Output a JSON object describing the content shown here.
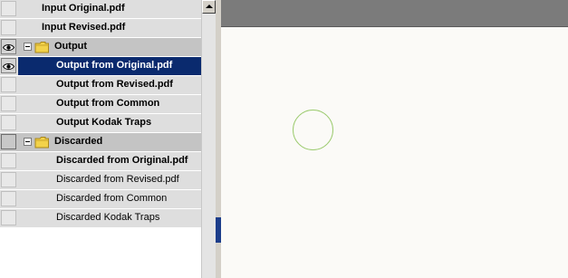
{
  "layers": [
    {
      "label": "Input Original.pdf",
      "type": "item",
      "indent": 0,
      "bold": true,
      "visible": false,
      "selected": false
    },
    {
      "label": "Input Revised.pdf",
      "type": "item",
      "indent": 0,
      "bold": true,
      "visible": false,
      "selected": false
    },
    {
      "label": "Output",
      "type": "group",
      "bold": true,
      "visible": true,
      "expanded": true,
      "icon": "folder-icon"
    },
    {
      "label": "Output from Original.pdf",
      "type": "item",
      "indent": 1,
      "bold": true,
      "visible": true,
      "selected": true
    },
    {
      "label": "Output from Revised.pdf",
      "type": "item",
      "indent": 1,
      "bold": true,
      "visible": false,
      "selected": false
    },
    {
      "label": "Output from Common",
      "type": "item",
      "indent": 1,
      "bold": true,
      "visible": false,
      "selected": false
    },
    {
      "label": "Output Kodak Traps",
      "type": "item",
      "indent": 1,
      "bold": true,
      "visible": false,
      "selected": false
    },
    {
      "label": "Discarded",
      "type": "group",
      "bold": true,
      "visible": false,
      "expanded": true,
      "icon": "folder-icon"
    },
    {
      "label": "Discarded from Original.pdf",
      "type": "item",
      "indent": 1,
      "bold": true,
      "visible": false,
      "selected": false
    },
    {
      "label": "Discarded from Revised.pdf",
      "type": "item",
      "indent": 1,
      "bold": false,
      "visible": false,
      "selected": false
    },
    {
      "label": "Discarded from Common",
      "type": "item",
      "indent": 1,
      "bold": false,
      "visible": false,
      "selected": false
    },
    {
      "label": "Discarded Kodak Traps",
      "type": "item",
      "indent": 1,
      "bold": false,
      "visible": false,
      "selected": false
    }
  ],
  "colors": {
    "selection": "#0a2a6e",
    "row_background": "#dedede",
    "group_background": "#c4c4c4",
    "canvas_top": "#7b7b7b",
    "canvas": "#fbfaf7",
    "circle_stroke": "#9ccb6f"
  },
  "icons": {
    "visibility": "eye-icon",
    "group": "folder-icon",
    "expander": "collapse-minus-icon",
    "scroll_up": "scroll-up-arrow-icon"
  }
}
